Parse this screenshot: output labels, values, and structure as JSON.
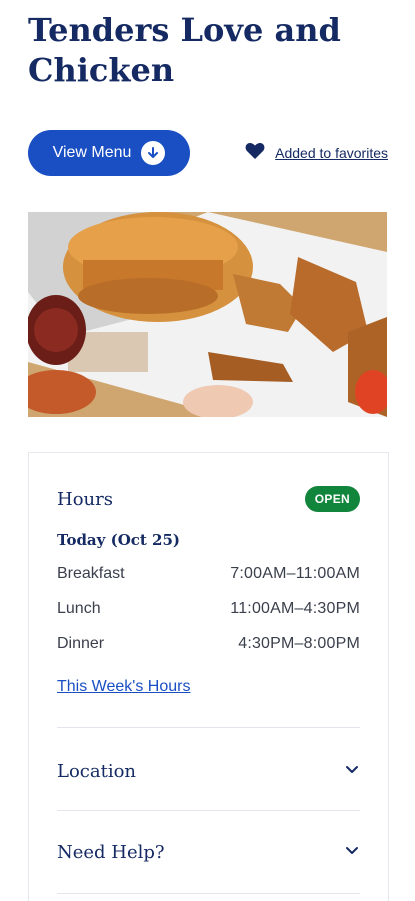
{
  "restaurant": {
    "title": "Tenders Love and Chicken"
  },
  "actions": {
    "view_menu_label": "View Menu",
    "favorite_label": "Added to favorites"
  },
  "hours": {
    "title": "Hours",
    "status": "OPEN",
    "today_label": "Today (Oct 25)",
    "rows": [
      {
        "meal": "Breakfast",
        "time": "7:00AM–11:00AM"
      },
      {
        "meal": "Lunch",
        "time": "11:00AM–4:30PM"
      },
      {
        "meal": "Dinner",
        "time": "4:30PM–8:00PM"
      }
    ],
    "week_link": "This Week's Hours"
  },
  "sections": {
    "location": "Location",
    "help": "Need Help?"
  },
  "icons": {
    "menu": "download-arrow-icon",
    "favorite": "heart-icon",
    "location_chevron": "chevron-down-icon",
    "help_chevron": "chevron-down-icon"
  },
  "colors": {
    "primary_blue": "#1a4fc3",
    "navy": "#152a63",
    "open_green": "#12853c"
  }
}
